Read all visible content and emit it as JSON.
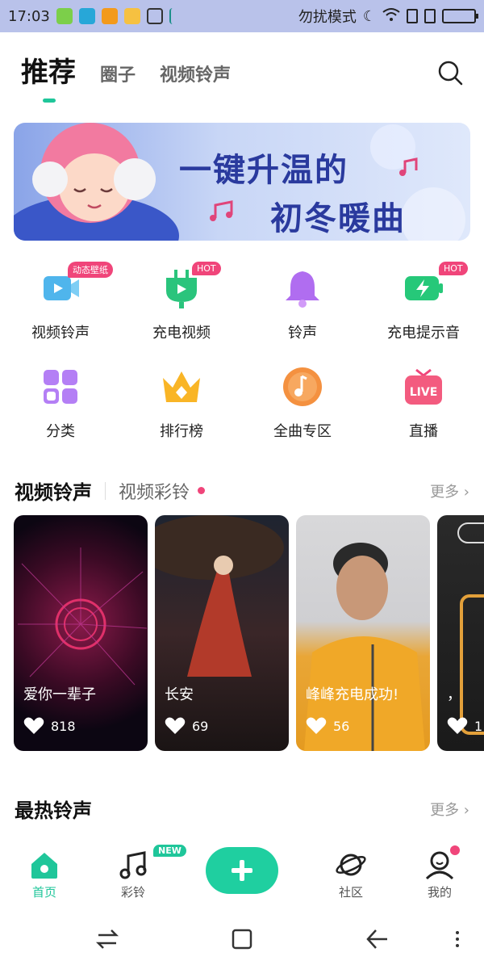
{
  "status": {
    "time": "17:03",
    "mode_text": "勿扰模式"
  },
  "tabs": [
    {
      "label": "推荐",
      "active": true
    },
    {
      "label": "圈子",
      "active": false
    },
    {
      "label": "视频铃声",
      "active": false
    }
  ],
  "banner": {
    "line1": "一键升温的",
    "line2": "初冬暖曲"
  },
  "grid": [
    {
      "label": "视频铃声",
      "icon": "video-ringtone-icon",
      "badge": "动态壁纸"
    },
    {
      "label": "充电视频",
      "icon": "charge-video-icon",
      "badge": "HOT"
    },
    {
      "label": "铃声",
      "icon": "bell-icon",
      "badge": ""
    },
    {
      "label": "充电提示音",
      "icon": "charge-sound-icon",
      "badge": "HOT"
    },
    {
      "label": "分类",
      "icon": "category-icon",
      "badge": ""
    },
    {
      "label": "排行榜",
      "icon": "crown-icon",
      "badge": ""
    },
    {
      "label": "全曲专区",
      "icon": "music-disc-icon",
      "badge": ""
    },
    {
      "label": "直播",
      "icon": "live-tv-icon",
      "badge": ""
    }
  ],
  "video_section": {
    "title": "视频铃声",
    "subtitle": "视频彩铃",
    "more": "更多 ›"
  },
  "cards": [
    {
      "title": "爱你一辈子",
      "likes": "818"
    },
    {
      "title": "长安",
      "likes": "69"
    },
    {
      "title": "峰峰充电成功!",
      "likes": "56"
    },
    {
      "title": "，",
      "likes": "1"
    }
  ],
  "hot_section": {
    "title": "最热铃声",
    "more": "更多 ›"
  },
  "bottom_tabs": [
    {
      "label": "首页",
      "icon": "home-icon",
      "active": true
    },
    {
      "label": "彩铃",
      "icon": "music-note-icon",
      "active": false,
      "badge": "NEW"
    },
    {
      "label": "",
      "icon": "plus-icon",
      "active": false
    },
    {
      "label": "社区",
      "icon": "planet-icon",
      "active": false
    },
    {
      "label": "我的",
      "icon": "profile-icon",
      "active": false
    }
  ],
  "colors": {
    "accent": "#1fc69a",
    "badge": "#f0457a",
    "status_bar": "#b9c2ea"
  }
}
